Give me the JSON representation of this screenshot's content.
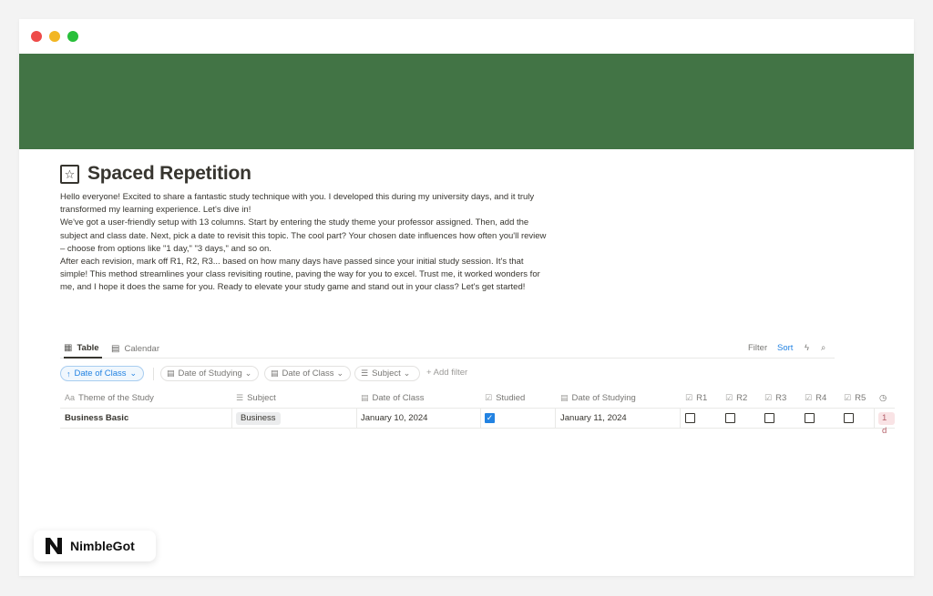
{
  "page": {
    "title": "Spaced Repetition",
    "description": [
      "Hello everyone! Excited to share a fantastic study technique with you. I developed this during my university days, and it truly transformed my learning experience. Let's dive in!",
      "We've got a user-friendly setup with 13 columns. Start by entering the study theme your professor assigned. Then, add the subject and class date. Next, pick a date to revisit this topic. The cool part? Your chosen date influences how often you'll review – choose from options like \"1 day,\" \"3 days,\" and so on.",
      "After each revision, mark off R1, R2, R3... based on how many days have passed since your initial study session. It's that simple! This method streamlines your class revisiting routine, paving the way for you to excel. Trust me, it worked wonders for me, and I hope it does the same for you. Ready to elevate your study game and stand out in your class? Let's get started!"
    ]
  },
  "views": {
    "table_label": "Table",
    "calendar_label": "Calendar",
    "filter_label": "Filter",
    "sort_label": "Sort"
  },
  "filters": {
    "sort_chip": "Date of Class",
    "chips": [
      "Date of Studying",
      "Date of Class",
      "Subject"
    ],
    "add_filter": "Add filter"
  },
  "table": {
    "columns": [
      "Theme of the Study",
      "Subject",
      "Date of Class",
      "Studied",
      "Date of Studying",
      "R1",
      "R2",
      "R3",
      "R4",
      "R5"
    ],
    "column_icons": [
      "Aa",
      "list-icon",
      "calendar-icon",
      "checkbox-icon",
      "calendar-icon",
      "checkbox-icon",
      "checkbox-icon",
      "checkbox-icon",
      "checkbox-icon",
      "checkbox-icon"
    ],
    "rows": [
      {
        "theme": "Business Basic",
        "subject": "Business",
        "date_of_class": "January 10, 2024",
        "studied": true,
        "date_of_studying": "January 11, 2024",
        "r": [
          false,
          false,
          false,
          false,
          false
        ],
        "next_tag": "1 d"
      }
    ]
  },
  "brand": {
    "name": "NimbleGot"
  },
  "colors": {
    "cover": "#427445",
    "accent": "#2383e2",
    "text": "#37352f"
  }
}
